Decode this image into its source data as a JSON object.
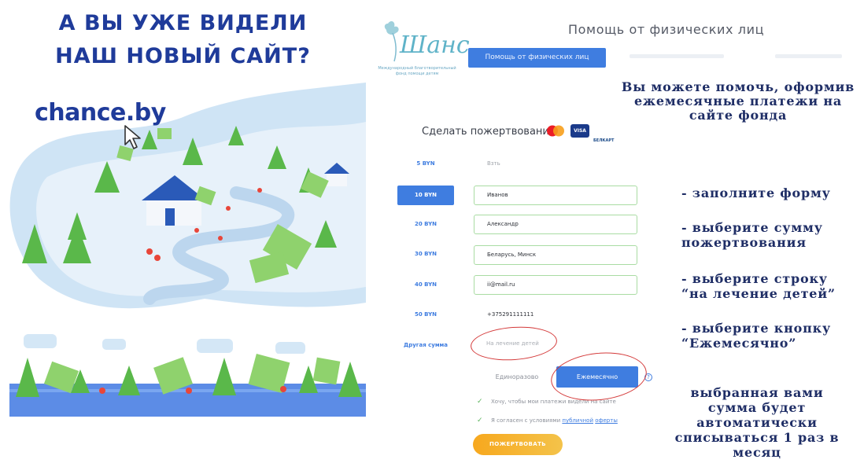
{
  "poster": {
    "headline_line1": "А ВЫ УЖЕ ВИДЕЛИ",
    "headline_line2": "НАШ НОВЫЙ САЙТ?",
    "website": "chance.by"
  },
  "site": {
    "logo": {
      "word": "Шанс",
      "subtitle": "Международный благотворительный фонд помощи детям"
    },
    "page_heading": "Помощь от физических лиц",
    "nav": {
      "primary": "Помощь от физических лиц"
    },
    "donation_form": {
      "title": "Сделать пожертвование",
      "card_visa": "VISA",
      "card_belkart": "БЕЛКАРТ",
      "amounts": [
        "5 BYN",
        "10 BYN",
        "20 BYN",
        "30 BYN",
        "40 BYN",
        "50 BYN",
        "Другая сумма"
      ],
      "fields": {
        "first": "Bзть",
        "last_name": "Иванов",
        "first_name": "Александр",
        "location": "Беларусь, Минск",
        "email": "ii@mail.ru",
        "phone": "+375291111111",
        "purpose": "На лечение детей"
      },
      "button_once": "Единоразово",
      "button_monthly": "Ежемесячно",
      "help_icon": "?",
      "check_1": "Хочу, чтобы мои платежи видели на сайте",
      "check_2_prefix": "Я согласен с условиями ",
      "check_2_link1": "публичной",
      "check_2_link2": "оферты",
      "submit": "ПОЖЕРТВОВАТЬ"
    }
  },
  "instructions": {
    "intro": "Вы можете помочь, оформив ежемесячные платежи на сайте фонда",
    "step_1": "- заполните форму",
    "step_2": "- выберите сумму пожертвования",
    "step_3": "- выберите строку “на лечение детей”",
    "step_4": "- выберите кнопку “Ежемесячно”",
    "auto_note": "выбранная вами сумма будет автоматически списываться 1 раз в месяц"
  },
  "colors": {
    "headline": "#1f3b9a",
    "accent_blue": "#3f7de0",
    "submit_orange": "#f7a81e",
    "highlight_red": "#d43a3a",
    "field_border": "#a9dca3"
  }
}
